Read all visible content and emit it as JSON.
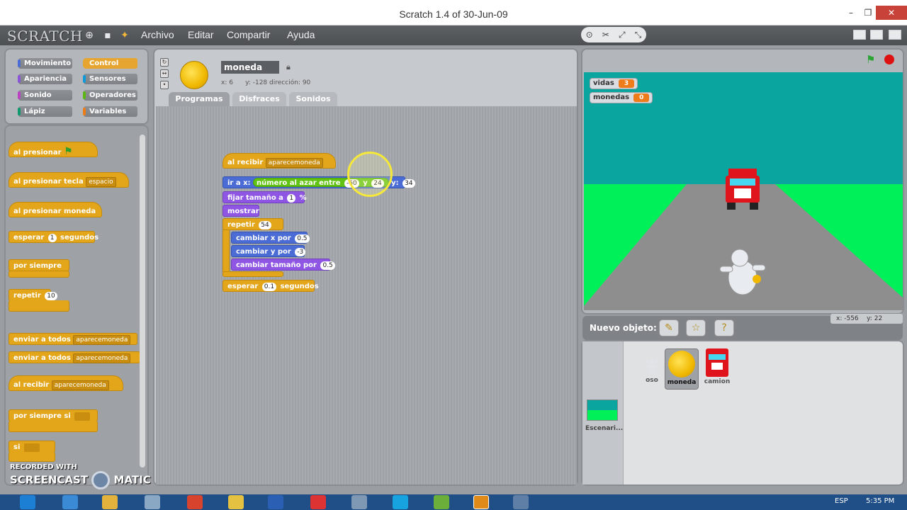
{
  "window": {
    "title": "Scratch 1.4 of 30-Jun-09",
    "minimize": "–",
    "maximize": "❐",
    "close": "✕"
  },
  "app": {
    "logo": "SCRATCH"
  },
  "menu": {
    "items": [
      "Archivo",
      "Editar",
      "Compartir",
      "Ayuda"
    ]
  },
  "categories": [
    {
      "label": "Movimiento",
      "color": "#4a6cd4"
    },
    {
      "label": "Control",
      "color": "#e6a530"
    },
    {
      "label": "Apariencia",
      "color": "#8a55d7"
    },
    {
      "label": "Sensores",
      "color": "#0e9ad8"
    },
    {
      "label": "Sonido",
      "color": "#bb42c3"
    },
    {
      "label": "Operadores",
      "color": "#5cb712"
    },
    {
      "label": "Lápiz",
      "color": "#0e9a6c"
    },
    {
      "label": "Variables",
      "color": "#ee7d16"
    }
  ],
  "palette": {
    "flag_hat": "al presionar",
    "key_hat": "al presionar tecla",
    "key_value": "espacio",
    "sprite_hat": "al presionar moneda",
    "wait": "esperar",
    "wait_value": "1",
    "wait_unit": "segundos",
    "forever": "por siempre",
    "repeat": "repetir",
    "repeat_value": "10",
    "broadcast": "enviar a todos",
    "broadcast_value": "aparecemoneda",
    "broadcast_wait": "enviar a todos",
    "broadcast_wait_value": "aparecemoneda",
    "receive": "al recibir",
    "receive_value": "aparecemoneda",
    "forever_if": "por siempre si",
    "if": "si"
  },
  "sprite": {
    "name": "moneda",
    "x_label": "x:",
    "x": "6",
    "y_label": "y:",
    "y": "-128",
    "dir_label": "dirección:",
    "dir": "90"
  },
  "tabs": [
    "Programas",
    "Disfraces",
    "Sonidos"
  ],
  "script": {
    "receive": "al recibir",
    "receive_value": "aparecemoneda",
    "goto": "ir a x:",
    "random": "número al azar entre",
    "random_from": "-60",
    "random_and": "y",
    "random_to": "24",
    "goto_y": "y:",
    "goto_y_value": "34",
    "setsize": "fijar tamaño a",
    "setsize_value": "1",
    "setsize_unit": "%",
    "show": "mostrar",
    "repeat": "repetir",
    "repeat_value": "54",
    "changex": "cambiar x por",
    "changex_value": "0.5",
    "changey": "cambiar y por",
    "changey_value": "-3",
    "changesize": "cambiar tamaño por",
    "changesize_value": "0.5",
    "wait": "esperar",
    "wait_value": "0.1",
    "wait_unit": "segundos"
  },
  "stage": {
    "vars": [
      {
        "name": "vidas",
        "value": "3"
      },
      {
        "name": "monedas",
        "value": "0"
      }
    ],
    "sky_color": "#0aa59f",
    "grass_color": "#00f05a",
    "road_color": "#8e8e8e"
  },
  "new_sprite": {
    "label": "Nuevo objeto:"
  },
  "mouse": {
    "x_label": "x:",
    "x": "-556",
    "y_label": "y:",
    "y": "22"
  },
  "sprites": [
    {
      "name": "oso"
    },
    {
      "name": "moneda"
    },
    {
      "name": "camion"
    }
  ],
  "stage_thumb": {
    "label": "Escenari..."
  },
  "taskbar": {
    "lang": "ESP",
    "time": "5:35 PM"
  },
  "watermark": {
    "line1": "RECORDED WITH",
    "line2": "SCREENCAST",
    "line3": "MATIC"
  }
}
